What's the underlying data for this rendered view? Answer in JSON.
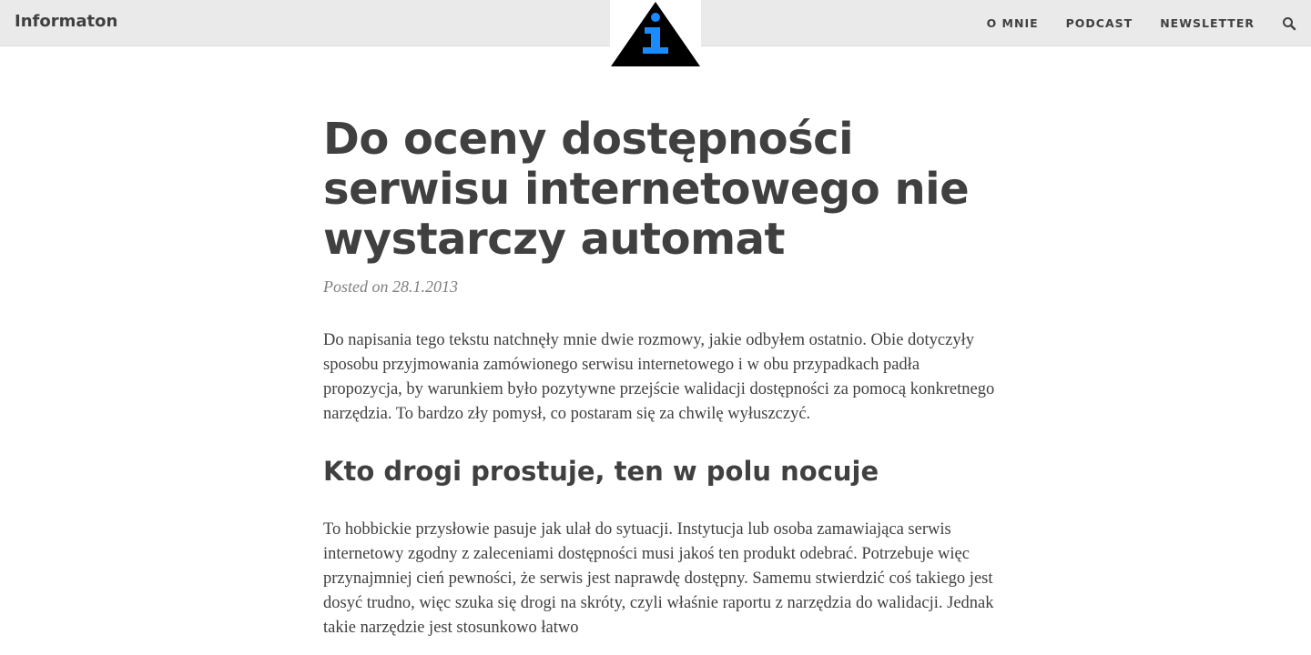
{
  "navbar": {
    "brand": "Informaton",
    "links": [
      {
        "label": "O MNIE"
      },
      {
        "label": "PODCAST"
      },
      {
        "label": "NEWSLETTER"
      }
    ],
    "search_icon": "search-icon"
  },
  "logo": {
    "glyph": "i",
    "triangle_color": "#000000",
    "glyph_color": "#1a8cff"
  },
  "post": {
    "title": "Do oceny dostępności serwisu internetowego nie wystarczy automat",
    "meta": "Posted on 28.1.2013",
    "intro": "Do napisania tego tekstu natchnęły mnie dwie rozmowy, jakie odbyłem ostatnio. Obie dotyczyły sposobu przyjmowania zamówionego serwisu internetowego i w obu przypadkach padła propozycja, by warunkiem było pozytywne przejście walidacji dostępności za pomocą konkretnego narzędzia. To bardzo zły pomysł, co postaram się za chwilę wyłuszczyć.",
    "section_heading": "Kto drogi prostuje, ten w polu nocuje",
    "section_text": "To hobbickie przysłowie pasuje jak ulał do sytuacji. Instytucja lub osoba zamawiająca serwis internetowy zgodny z zaleceniami dostępności musi jakoś ten produkt odebrać. Potrzebuje więc przynajmniej cień pewności, że serwis jest naprawdę dostępny. Samemu stwierdzić coś takiego jest dosyć trudno, więc szuka się drogi na skróty, czyli właśnie raportu z narzędzia do walidacji. Jednak takie narzędzie jest stosunkowo łatwo"
  },
  "colors": {
    "navbar_bg": "#eaeaea",
    "text": "#404040",
    "meta": "#808080"
  }
}
